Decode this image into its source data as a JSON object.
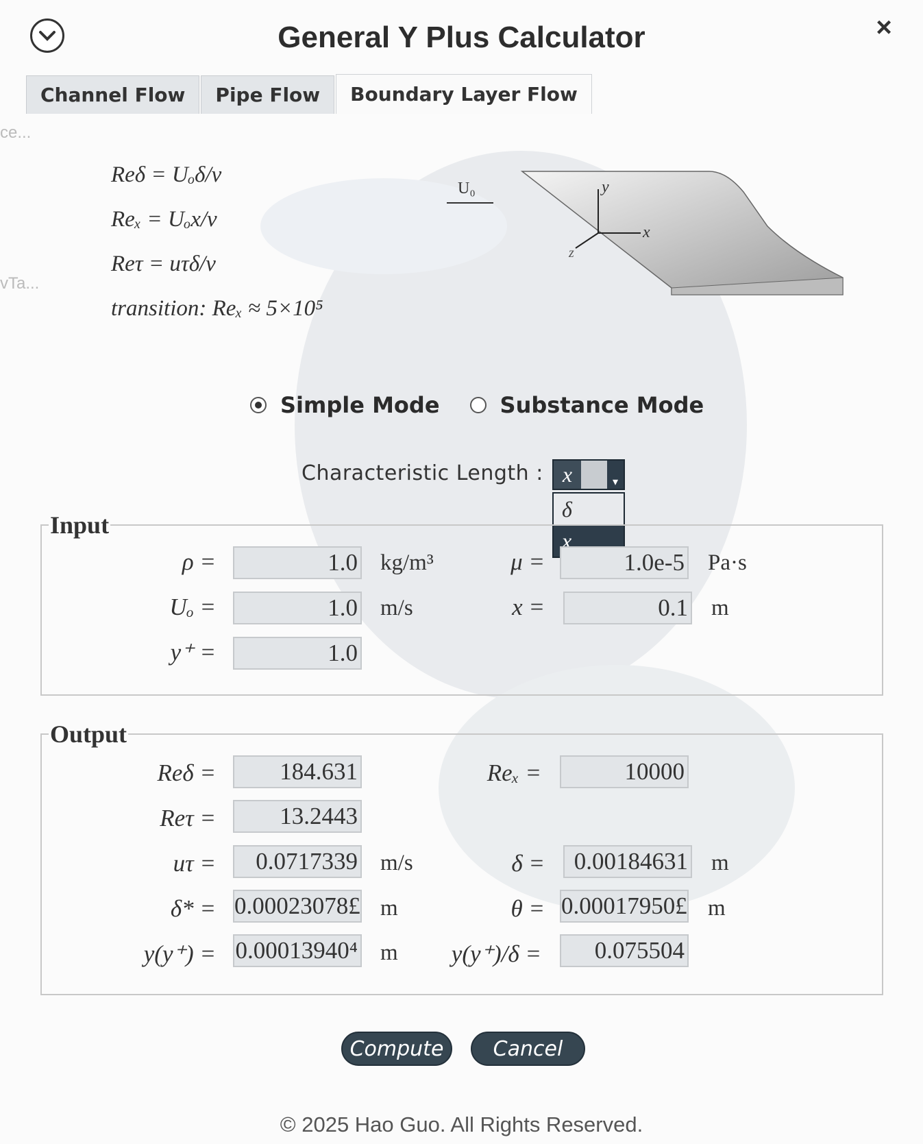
{
  "app": {
    "title": "General Y Plus Calculator"
  },
  "tabs": [
    {
      "label": "Channel Flow",
      "active": false
    },
    {
      "label": "Pipe Flow",
      "active": false
    },
    {
      "label": "Boundary Layer Flow",
      "active": true
    }
  ],
  "formulas": [
    "Reδ = Uₒδ/ν",
    "Reₓ = Uₒx/ν",
    "Reτ = uτδ/ν",
    "transition: Reₓ ≈ 5×10⁵"
  ],
  "diagram": {
    "velocity_label": "U₀",
    "axis_x": "x",
    "axis_y": "y",
    "axis_z": "z"
  },
  "mode": {
    "options": [
      "Simple Mode",
      "Substance Mode"
    ],
    "selected": "Simple Mode"
  },
  "characteristic_length": {
    "label": "Characteristic  Length :",
    "value": "x",
    "options": [
      "δ",
      "x"
    ],
    "highlighted": "x"
  },
  "input": {
    "legend": "Input",
    "rho": {
      "label": "ρ =",
      "value": "1.0",
      "unit": "kg/m³"
    },
    "mu": {
      "label": "μ =",
      "value": "1.0e-5",
      "unit": "Pa·s"
    },
    "U0": {
      "label": "Uₒ =",
      "value": "1.0",
      "unit": "m/s"
    },
    "x": {
      "label": "x =",
      "value": "0.1",
      "unit": "m"
    },
    "yplus": {
      "label": "y⁺ =",
      "value": "1.0"
    }
  },
  "output": {
    "legend": "Output",
    "Re_delta": {
      "label": "Reδ =",
      "value": "184.631"
    },
    "Re_x": {
      "label": "Reₓ =",
      "value": "10000"
    },
    "Re_tau": {
      "label": "Reτ =",
      "value": "13.2443"
    },
    "u_tau": {
      "label": "uτ =",
      "value": "0.0717339",
      "unit": "m/s"
    },
    "delta": {
      "label": "δ =",
      "value": "0.00184631",
      "unit": "m"
    },
    "delta_star": {
      "label": "δ* =",
      "value": "0.00023078£",
      "unit": "m"
    },
    "theta": {
      "label": "θ =",
      "value": "0.00017950£",
      "unit": "m"
    },
    "y_yplus": {
      "label": "y(y⁺) =",
      "value": "0.00013940⁴",
      "unit": "m"
    },
    "y_ratio": {
      "label": "y(y⁺)/δ =",
      "value": "0.075504"
    }
  },
  "buttons": {
    "compute": "Compute",
    "cancel": "Cancel"
  },
  "footer": "© 2025 Hao Guo. All Rights Reserved.",
  "side_ghost": [
    "ce...",
    "vTa..."
  ]
}
